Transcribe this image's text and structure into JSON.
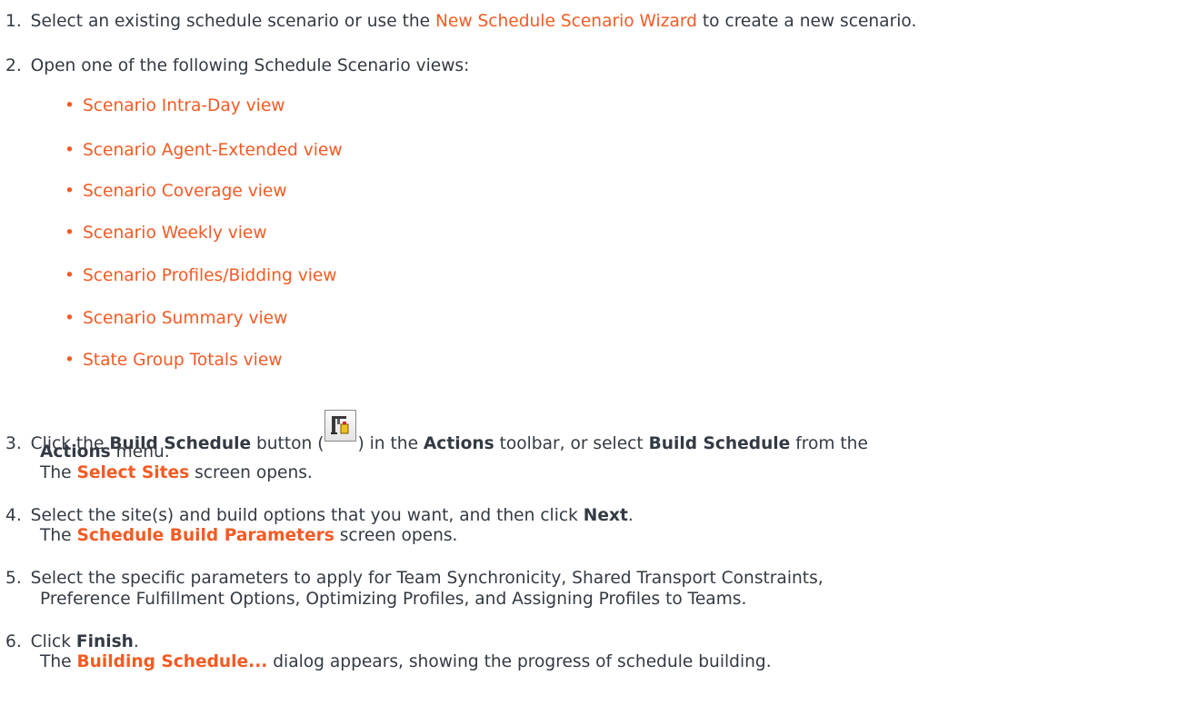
{
  "steps": [
    {
      "number": "1.",
      "text_before": "Select an existing schedule scenario or use the ",
      "link": "New Schedule Scenario Wizard",
      "text_after": " to create a new scenario."
    },
    {
      "number": "2.",
      "text": "Open one of the following Schedule Scenario views:",
      "bullets": [
        "Scenario Intra-Day view",
        "Scenario Agent-Extended view",
        "Scenario Coverage view",
        "Scenario Weekly view",
        "Scenario Profiles/Bidding view",
        "Scenario Summary view",
        "State Group Totals view"
      ]
    },
    {
      "number": "3.",
      "t1": "Click the ",
      "b1": "Build Schedule",
      "t2": " button (",
      "t3": ") in the ",
      "b2": "Actions",
      "t4": " toolbar, or select ",
      "b3": "Build Schedule",
      "t5": " from the",
      "b4": "Actions",
      "t6": " menu.",
      "l2_pre": "The ",
      "l2_link": "Select Sites",
      "l2_post": " screen opens.",
      "icon": "build-schedule-icon"
    },
    {
      "number": "4.",
      "t1": "Select the site(s) and build options that you want, and then click ",
      "b1": "Next",
      "t2": ".",
      "l2_pre": "The ",
      "l2_link": "Schedule Build Parameters",
      "l2_post": " screen opens."
    },
    {
      "number": "5.",
      "line1": "Select the specific parameters to apply for Team Synchronicity, Shared Transport Constraints,",
      "line2": "Preference Fulfillment Options, Optimizing Profiles, and Assigning Profiles to Teams."
    },
    {
      "number": "6.",
      "t1": "Click ",
      "b1": "Finish",
      "t2": ".",
      "l2_pre": "The ",
      "l2_link": "Building Schedule...",
      "l2_post": " dialog appears, showing the progress of schedule building."
    }
  ],
  "colors": {
    "text": "#333a44",
    "link": "#f35b24"
  }
}
